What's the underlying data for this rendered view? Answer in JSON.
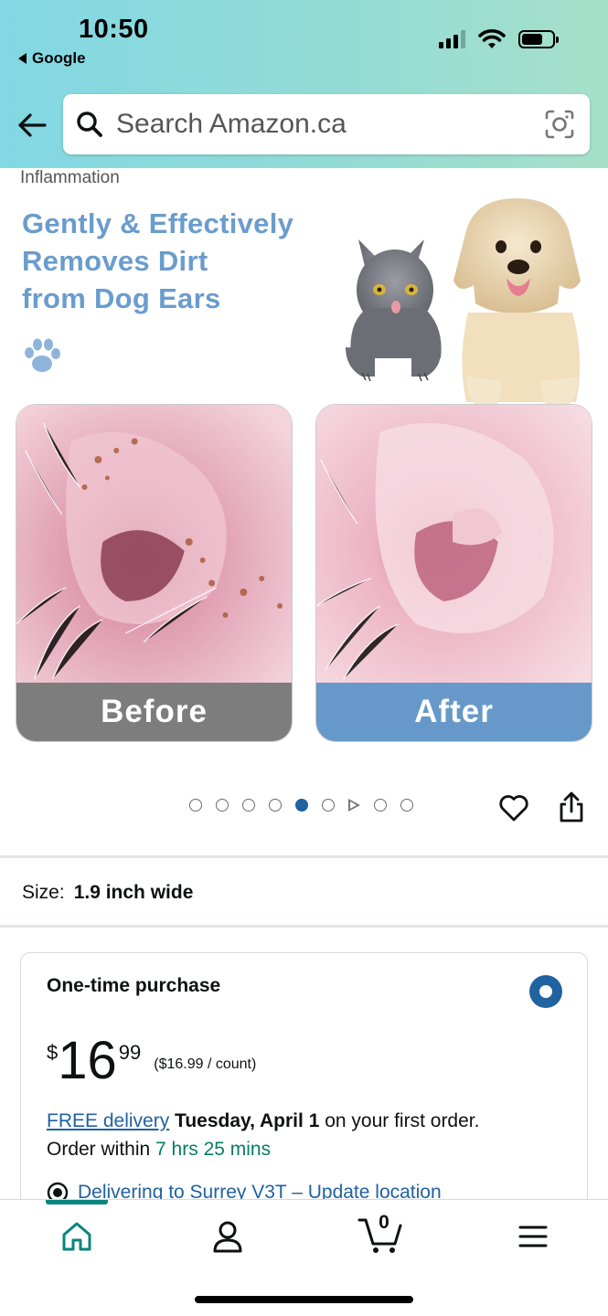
{
  "status_bar": {
    "time": "10:50",
    "back_app": "Google"
  },
  "header": {
    "search_placeholder": "Search Amazon.ca"
  },
  "product_image": {
    "cropped_caption": "Inflammation",
    "headline_lines": [
      "Gently & Effectively",
      "Removes Dirt",
      "from Dog Ears"
    ],
    "before_label": "Before",
    "after_label": "After"
  },
  "carousel": {
    "total": 9,
    "active_index": 4,
    "video_index": 6
  },
  "size": {
    "label": "Size:",
    "value": "1.9 inch wide"
  },
  "purchase": {
    "title": "One-time purchase",
    "selected": true,
    "price_symbol": "$",
    "price_whole": "16",
    "price_cents": "99",
    "unit_price": "($16.99 / count)",
    "delivery_link": "FREE delivery",
    "delivery_date": "Tuesday, April 1",
    "delivery_suffix": "on your first order.",
    "order_within_prefix": "Order within",
    "order_within_time": "7 hrs 25 mins",
    "location": "Delivering to Surrey V3T – Update location"
  },
  "bottom_nav": {
    "cart_count": "0"
  },
  "colors": {
    "header_gradient_start": "#82d8e3",
    "header_gradient_end": "#a6e0c9",
    "link_blue": "#2162a1",
    "accent_teal": "#08857f",
    "headline_blue": "#6a9ccd",
    "success_green": "#067d62"
  },
  "icons": [
    "back-arrow-icon",
    "search-icon",
    "camera-lens-icon",
    "paw-icon",
    "heart-icon",
    "share-icon",
    "location-pin-icon",
    "home-icon",
    "account-icon",
    "cart-icon",
    "menu-icon"
  ]
}
